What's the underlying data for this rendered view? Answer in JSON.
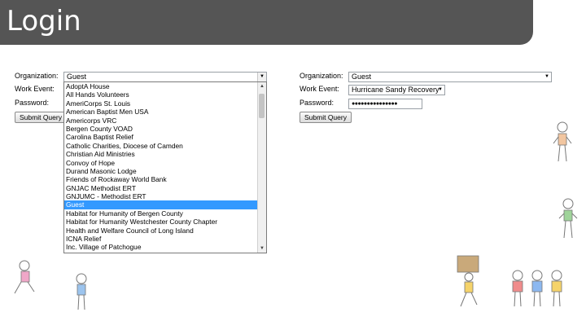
{
  "page_title": "Login",
  "left_form": {
    "org_label": "Organization:",
    "org_value": "Guest",
    "event_label": "Work Event:",
    "password_label": "Password:",
    "submit_label": "Submit Query",
    "options": [
      "AdoptA House",
      "All Hands Volunteers",
      "AmeriCorps St. Louis",
      "American Baptist Men USA",
      "Americorps VRC",
      "Bergen County VOAD",
      "Carolina Baptist Relief",
      "Catholic Charities, Diocese of Camden",
      "Christian Aid Ministries",
      "Convoy of Hope",
      "Durand Masonic Lodge",
      "Friends of Rockaway World Bank",
      "GNJAC Methodist ERT",
      "GNJUMC - Methodist ERT",
      "Guest",
      "Habitat for Humanity of Bergen County",
      "Habitat for Humanity Westchester County Chapter",
      "Health and Welfare Council of Long Island",
      "ICNA Relief",
      "Inc. Village of Patchogue"
    ],
    "selected_option": "Guest"
  },
  "right_form": {
    "org_label": "Organization:",
    "org_value": "Guest",
    "event_label": "Work Event:",
    "event_value": "Hurricane Sandy Recovery",
    "password_label": "Password:",
    "password_value": "●●●●●●●●●●●●●●●",
    "submit_label": "Submit Query"
  },
  "colors": {
    "title_bar": "#555555",
    "selection": "#3399ff"
  }
}
